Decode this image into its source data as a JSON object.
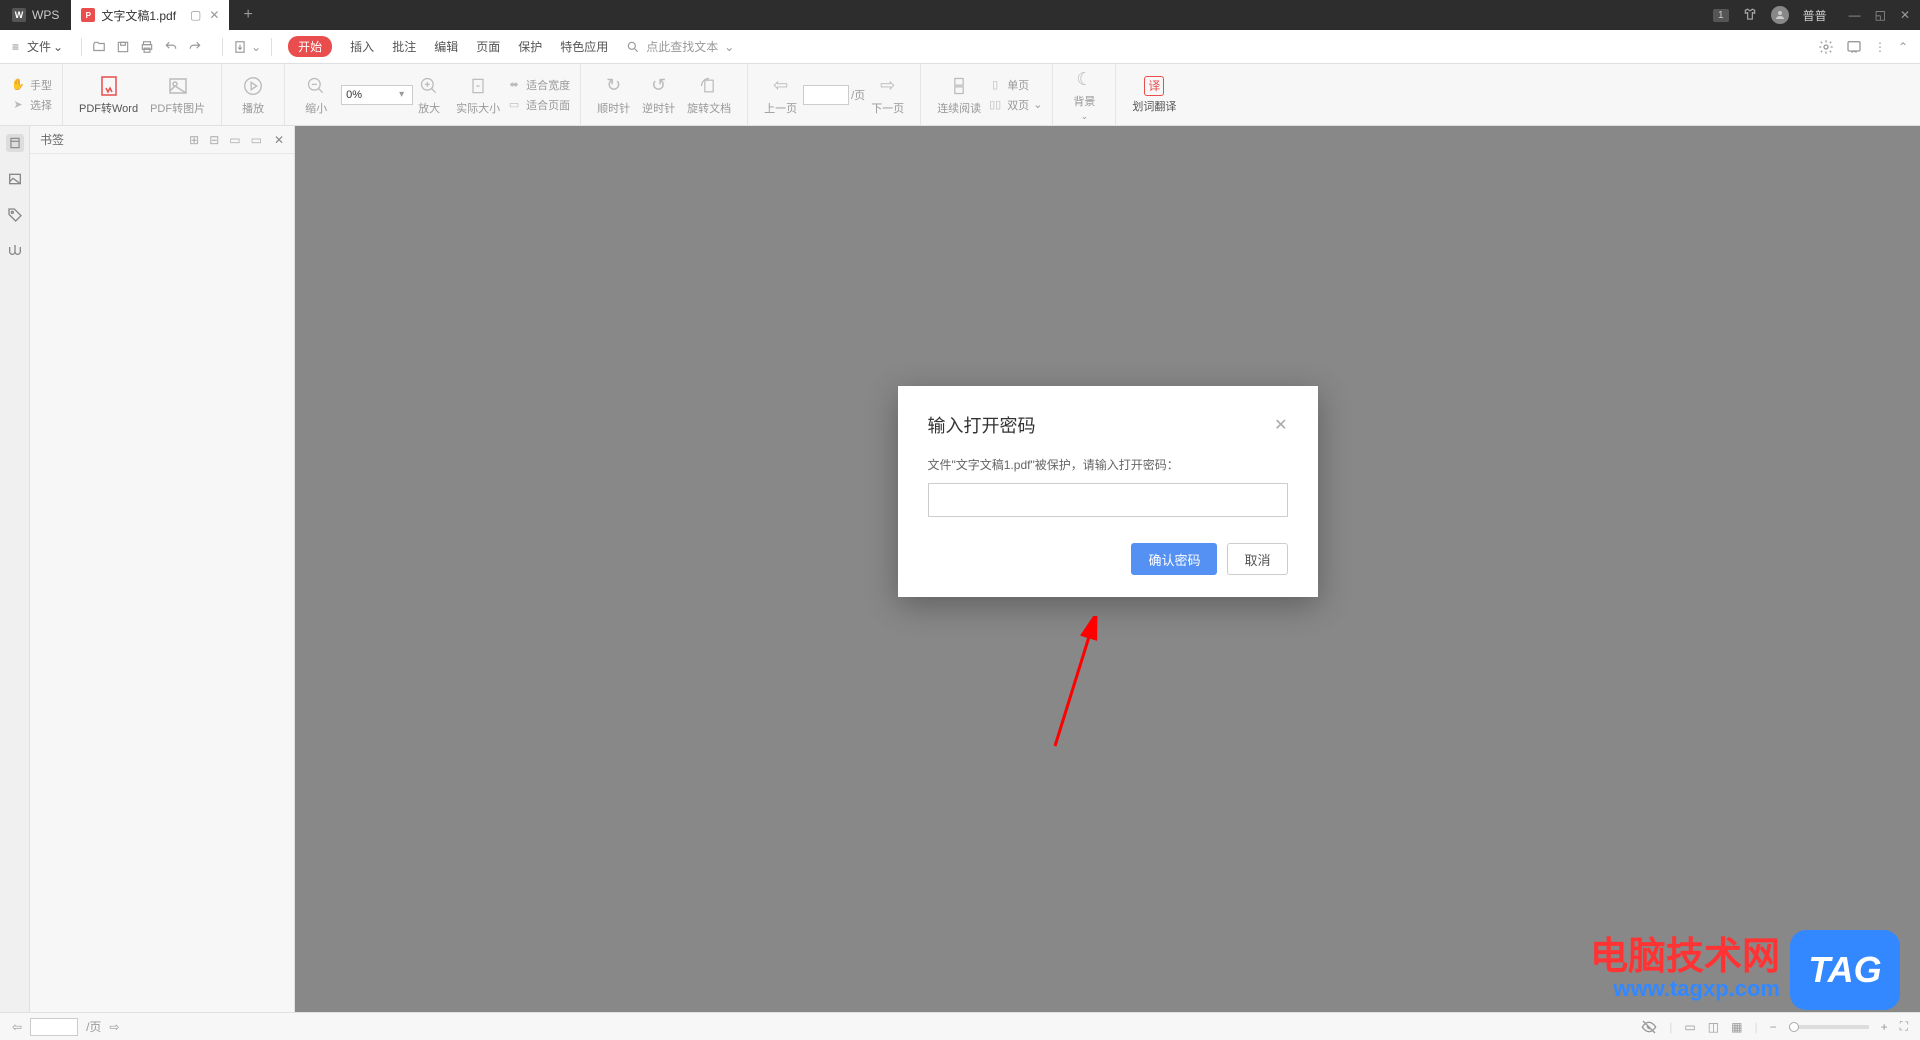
{
  "titlebar": {
    "app_name": "WPS",
    "file_tab": "文字文稿1.pdf",
    "badge": "1",
    "user_name": "普普"
  },
  "menubar": {
    "file_label": "文件",
    "tabs": [
      "开始",
      "插入",
      "批注",
      "编辑",
      "页面",
      "保护",
      "特色应用"
    ],
    "search_placeholder": "点此查找文本"
  },
  "toolbar": {
    "hand": "手型",
    "select": "选择",
    "pdf2word": "PDF转Word",
    "pdf2img": "PDF转图片",
    "play": "播放",
    "zoom_out": "缩小",
    "zoom_value": "0%",
    "zoom_in": "放大",
    "actual_size": "实际大小",
    "fit_width": "适合宽度",
    "fit_page": "适合页面",
    "rotate_cw": "顺时针",
    "rotate_ccw": "逆时针",
    "rotate_doc": "旋转文档",
    "prev_page": "上一页",
    "page_suffix": "/页",
    "next_page": "下一页",
    "continuous": "连续阅读",
    "single_page": "单页",
    "two_page": "双页",
    "background": "背景",
    "translate": "划词翻译"
  },
  "side": {
    "title": "书签"
  },
  "dialog": {
    "title": "输入打开密码",
    "message": "文件\"文字文稿1.pdf\"被保护，请输入打开密码：",
    "confirm": "确认密码",
    "cancel": "取消"
  },
  "statusbar": {
    "page_suffix": "/页"
  },
  "watermark": {
    "cn": "电脑技术网",
    "url": "www.tagxp.com",
    "tag": "TAG"
  }
}
